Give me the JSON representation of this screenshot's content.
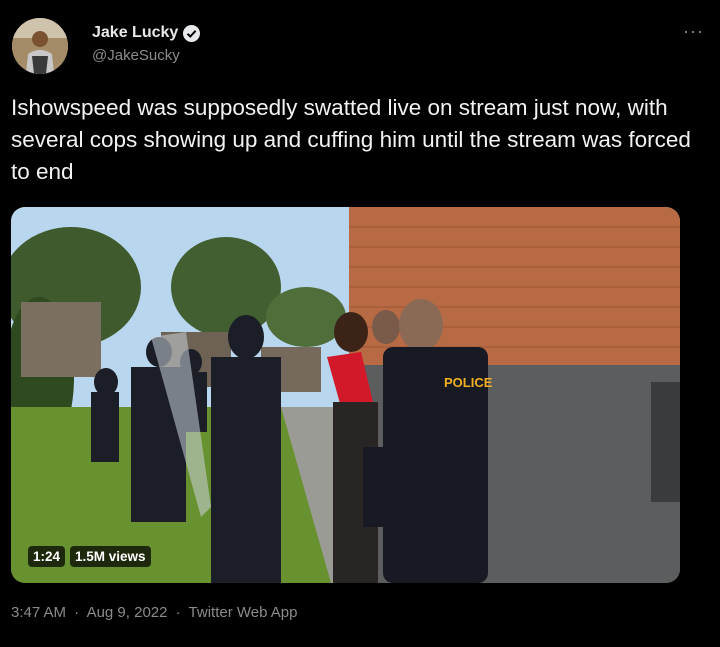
{
  "author": {
    "display_name": "Jake Lucky",
    "handle": "@JakeSucky",
    "verified_icon": "verified-badge-icon"
  },
  "more_label": "···",
  "tweet": {
    "text": "Ishowspeed was supposedly swatted live on stream just now, with several cops showing up and cuffing him until the stream was forced to end"
  },
  "media": {
    "duration": "1:24",
    "views": "1.5M views",
    "police_label": "POLICE"
  },
  "meta": {
    "time": "3:47 AM",
    "separator": "·",
    "date": "Aug 9, 2022",
    "source": "Twitter Web App"
  },
  "colors": {
    "background": "#000000",
    "text": "#e7e9ea",
    "secondary": "#8b8b8b",
    "police_label": "#f2b024"
  }
}
